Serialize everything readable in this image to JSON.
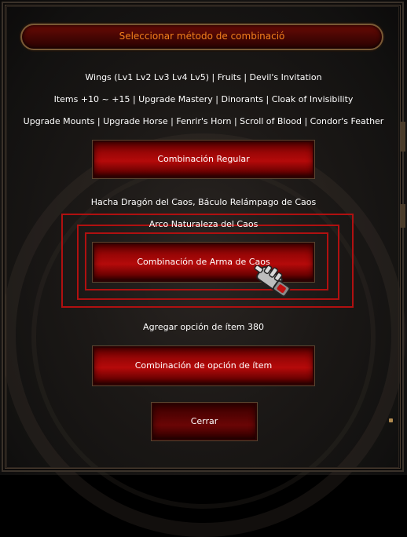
{
  "window": {
    "title": "Seleccionar método de combinació"
  },
  "info_lines": [
    "Wings (Lv1 Lv2 Lv3 Lv4 Lv5) | Fruits | Devil's Invitation",
    "Items +10 ~ +15 | Upgrade Mastery | Dinorants | Cloak of Invisibility",
    "Upgrade Mounts | Upgrade Horse | Fenrir's Horn | Scroll of Blood | Condor's Feather"
  ],
  "regular": {
    "button_label": "Combinación Regular"
  },
  "chaos_weapon": {
    "desc_line1": "Hacha Dragón del Caos, Báculo Relámpago de Caos",
    "desc_line2": "Arco Naturaleza del Caos",
    "button_label": "Combinación de Arma de Caos"
  },
  "option380": {
    "desc": "Agregar opción de ítem 380",
    "button_label": "Combinación de opción de ítem"
  },
  "close": {
    "button_label": "Cerrar"
  },
  "colors": {
    "title_text": "#f2801c",
    "button_red": "#b50a0a",
    "selection_border": "#b01010"
  },
  "icons": {
    "cursor": "gauntlet-hand-cursor-icon"
  }
}
